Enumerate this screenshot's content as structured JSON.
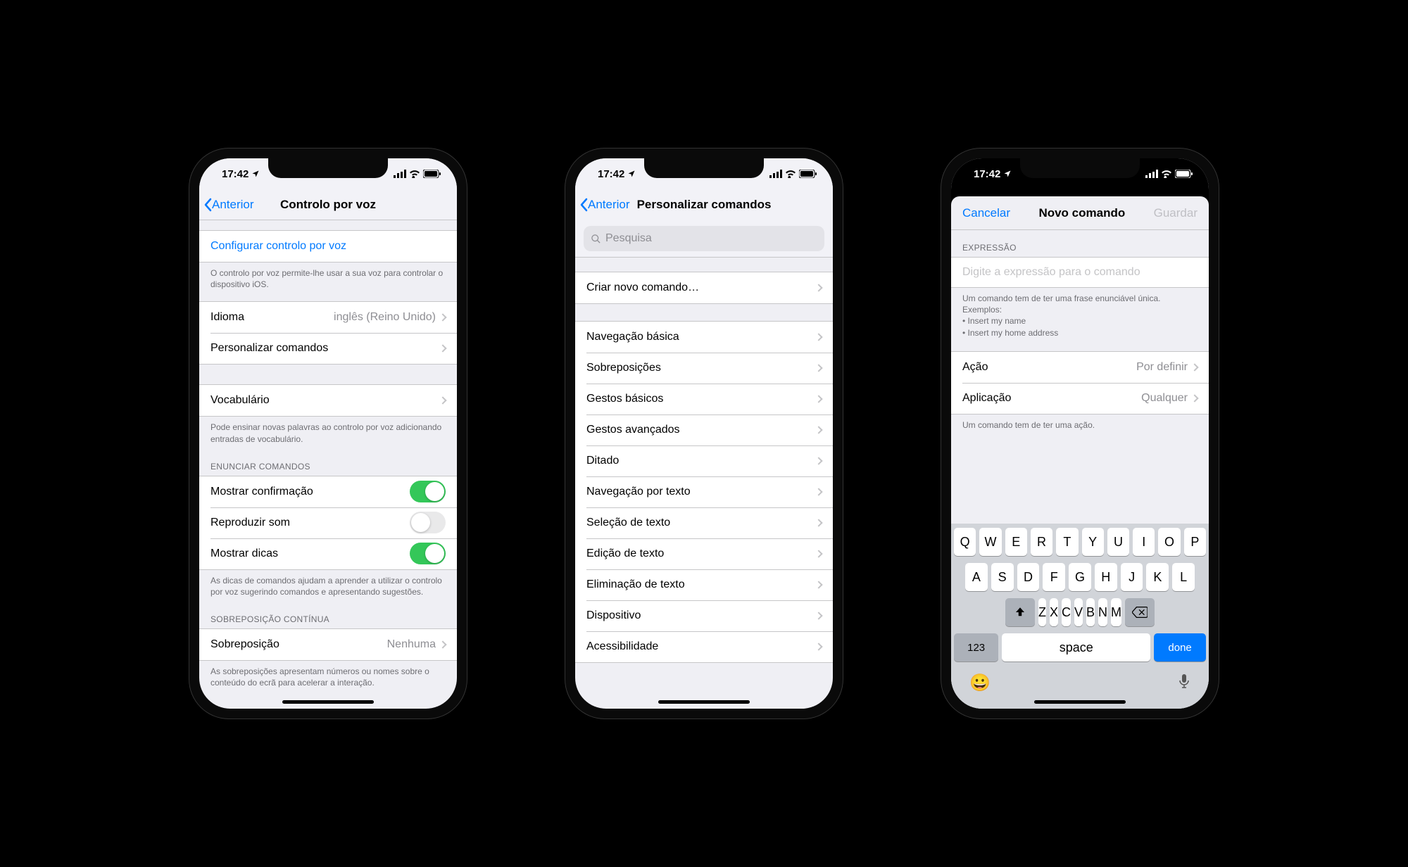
{
  "status": {
    "time": "17:42"
  },
  "phone1": {
    "back": "Anterior",
    "title": "Controlo por voz",
    "configure": "Configurar controlo por voz",
    "configure_footer": "O controlo por voz permite-lhe usar a sua voz para controlar o dispositivo iOS.",
    "language_label": "Idioma",
    "language_value": "inglês (Reino Unido)",
    "customize": "Personalizar comandos",
    "vocabulary": "Vocabulário",
    "vocab_footer": "Pode ensinar novas palavras ao controlo por voz adicionando entradas de vocabulário.",
    "enunciate_header": "ENUNCIAR COMANDOS",
    "show_confirm": "Mostrar confirmação",
    "play_sound": "Reproduzir som",
    "show_tips": "Mostrar dicas",
    "tips_footer": "As dicas de comandos ajudam a aprender a utilizar o controlo por voz sugerindo comandos e apresentando sugestões.",
    "overlay_header": "SOBREPOSIÇÃO CONTÍNUA",
    "overlay_label": "Sobreposição",
    "overlay_value": "Nenhuma",
    "overlay_footer": "As sobreposições apresentam números ou nomes sobre o conteúdo do ecrã para acelerar a interação."
  },
  "phone2": {
    "back": "Anterior",
    "title": "Personalizar comandos",
    "search_placeholder": "Pesquisa",
    "create": "Criar novo comando…",
    "groups": [
      "Navegação básica",
      "Sobreposições",
      "Gestos básicos",
      "Gestos avançados",
      "Ditado",
      "Navegação por texto",
      "Seleção de texto",
      "Edição de texto",
      "Eliminação de texto",
      "Dispositivo",
      "Acessibilidade"
    ]
  },
  "phone3": {
    "cancel": "Cancelar",
    "title": "Novo comando",
    "save": "Guardar",
    "expr_header": "EXPRESSÃO",
    "expr_placeholder": "Digite a expressão para o comando",
    "expr_footer1": "Um comando tem de ter uma frase enunciável única.",
    "expr_footer2": "Exemplos:",
    "expr_footer3": "• Insert my name",
    "expr_footer4": "• Insert my home address",
    "action_label": "Ação",
    "action_value": "Por definir",
    "app_label": "Aplicação",
    "app_value": "Qualquer",
    "action_footer": "Um comando tem de ter uma ação.",
    "kb": {
      "row1": [
        "Q",
        "W",
        "E",
        "R",
        "T",
        "Y",
        "U",
        "I",
        "O",
        "P"
      ],
      "row2": [
        "A",
        "S",
        "D",
        "F",
        "G",
        "H",
        "J",
        "K",
        "L"
      ],
      "row3": [
        "Z",
        "X",
        "C",
        "V",
        "B",
        "N",
        "M"
      ],
      "num": "123",
      "space": "space",
      "done": "done"
    }
  }
}
